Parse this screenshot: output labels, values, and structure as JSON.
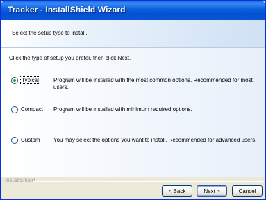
{
  "window": {
    "title": "Tracker - InstallShield Wizard"
  },
  "header": {
    "text": "Select the setup type to install."
  },
  "content": {
    "instruction": "Click the type of setup you prefer, then click Next.",
    "options": [
      {
        "label": "Typical",
        "selected": true,
        "description": "Program will be installed with the most common options.  Recommended for most users."
      },
      {
        "label": "Compact",
        "selected": false,
        "description": "Program will be installed with minimum required options."
      },
      {
        "label": "Custom",
        "selected": false,
        "description": "You may select the options you want to install. Recommended for advanced users."
      }
    ]
  },
  "footer": {
    "brand": "InstallShield",
    "back_label": "< Back",
    "next_label": "Next >",
    "cancel_label": "Cancel"
  }
}
